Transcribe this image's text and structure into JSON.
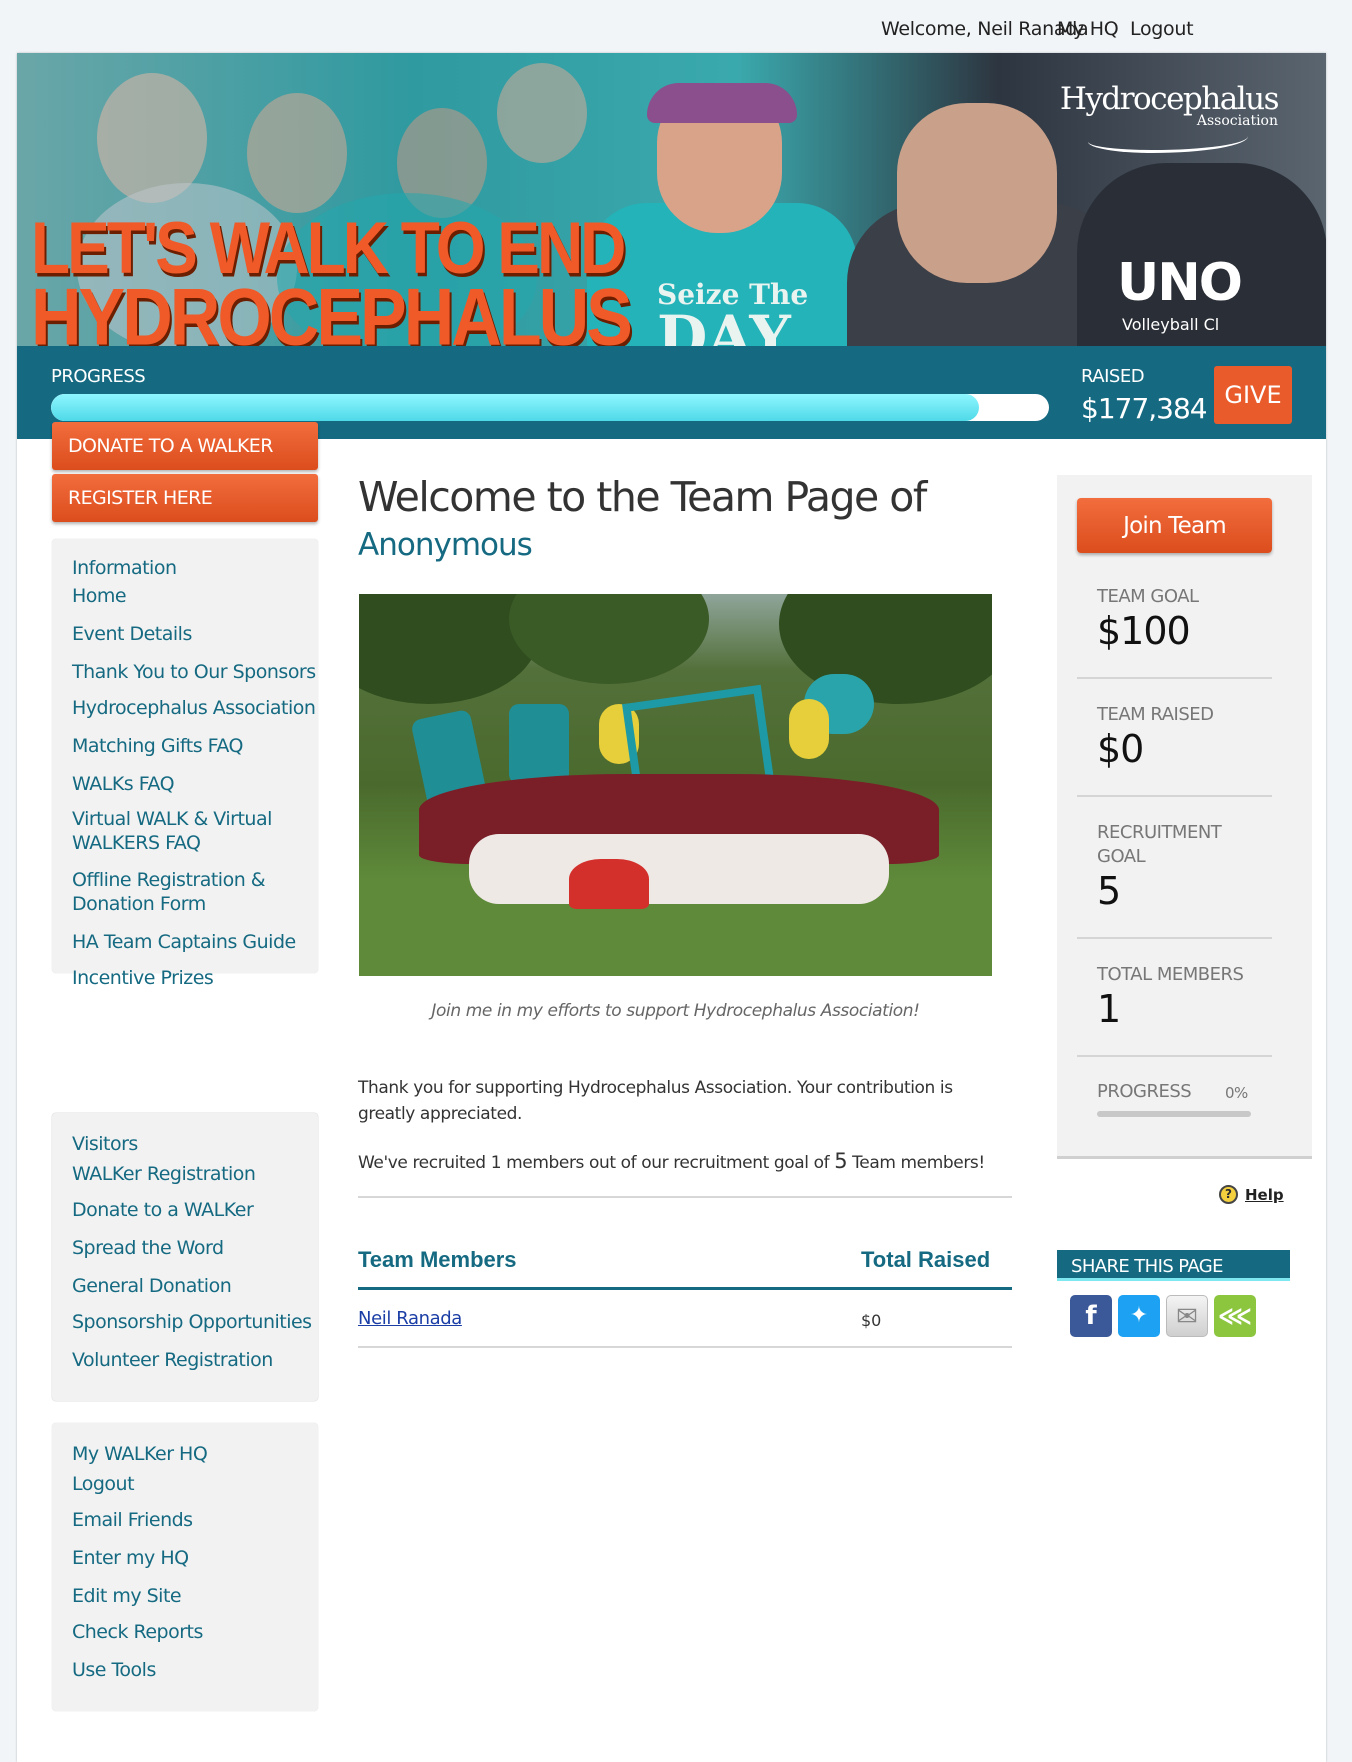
{
  "topnav": {
    "welcome": "Welcome, Neil Ranada",
    "hq": "My HQ",
    "logout": "Logout"
  },
  "banner": {
    "slogan_line1": "LET'S WALK TO END",
    "slogan_line2": "HYDROCEPHALUS",
    "logo_title": "Hydrocephalus",
    "logo_sub": "Association",
    "shirt_text1": "Seize The",
    "shirt_text2": "DAY",
    "jacket_text1": "UNO",
    "jacket_text2": "Volleyball Cl"
  },
  "progress": {
    "label": "PROGRESS",
    "fill_fraction": 0.93,
    "raised_label": "RAISED",
    "raised_value": "$177,384",
    "give_label": "GIVE"
  },
  "sidebar": {
    "donate_button": "DONATE TO A WALKER",
    "register_button": "REGISTER HERE",
    "info": {
      "heading": "Information",
      "links": [
        "Home",
        "Event Details",
        "Thank You to Our Sponsors",
        "Hydrocephalus Association",
        "Matching Gifts FAQ",
        "WALKs FAQ",
        "Virtual WALK & Virtual WALKERS FAQ",
        "Offline Registration & Donation Form",
        "HA Team Captains Guide",
        "Incentive Prizes"
      ]
    },
    "visitors": {
      "heading": "Visitors",
      "links": [
        "WALKer Registration",
        "Donate to a WALKer",
        "Spread the Word",
        "General Donation",
        "Sponsorship Opportunities",
        "Volunteer Registration"
      ]
    },
    "hq": {
      "heading": "My WALKer HQ",
      "links": [
        "Logout",
        "Email Friends",
        "Enter my HQ",
        "Edit my Site",
        "Check Reports",
        "Use Tools"
      ]
    }
  },
  "main": {
    "title": "Welcome to the Team Page of",
    "team_name": "Anonymous",
    "caption": "Join me in my efforts to support Hydrocephalus Association!",
    "thanks": "Thank you for supporting Hydrocephalus Association. Your contribution is greatly appreciated.",
    "recruit_pre": "We've recruited 1 members out of our recruitment goal of",
    "recruit_num": "5",
    "recruit_post": "Team members!",
    "table": {
      "headers": [
        "Team Members",
        "Total Raised"
      ],
      "rows": [
        {
          "name": "Neil Ranada",
          "raised": "$0"
        }
      ]
    }
  },
  "right": {
    "join_button": "Join Team",
    "stats": [
      {
        "label": "TEAM GOAL",
        "value": "$100"
      },
      {
        "label": "TEAM RAISED",
        "value": "$0"
      },
      {
        "label": "RECRUITMENT GOAL",
        "value": "5"
      },
      {
        "label": "TOTAL MEMBERS",
        "value": "1"
      }
    ],
    "progress_label": "PROGRESS",
    "progress_pct": "0%",
    "help": "Help",
    "share_title": "SHARE THIS PAGE",
    "share_icons": [
      "facebook-icon",
      "twitter-icon",
      "email-icon",
      "share-icon"
    ]
  },
  "colors": {
    "brand_teal": "#156a82",
    "accent_orange": "#e95b2b",
    "progress_cyan": "#4fd9e8"
  }
}
